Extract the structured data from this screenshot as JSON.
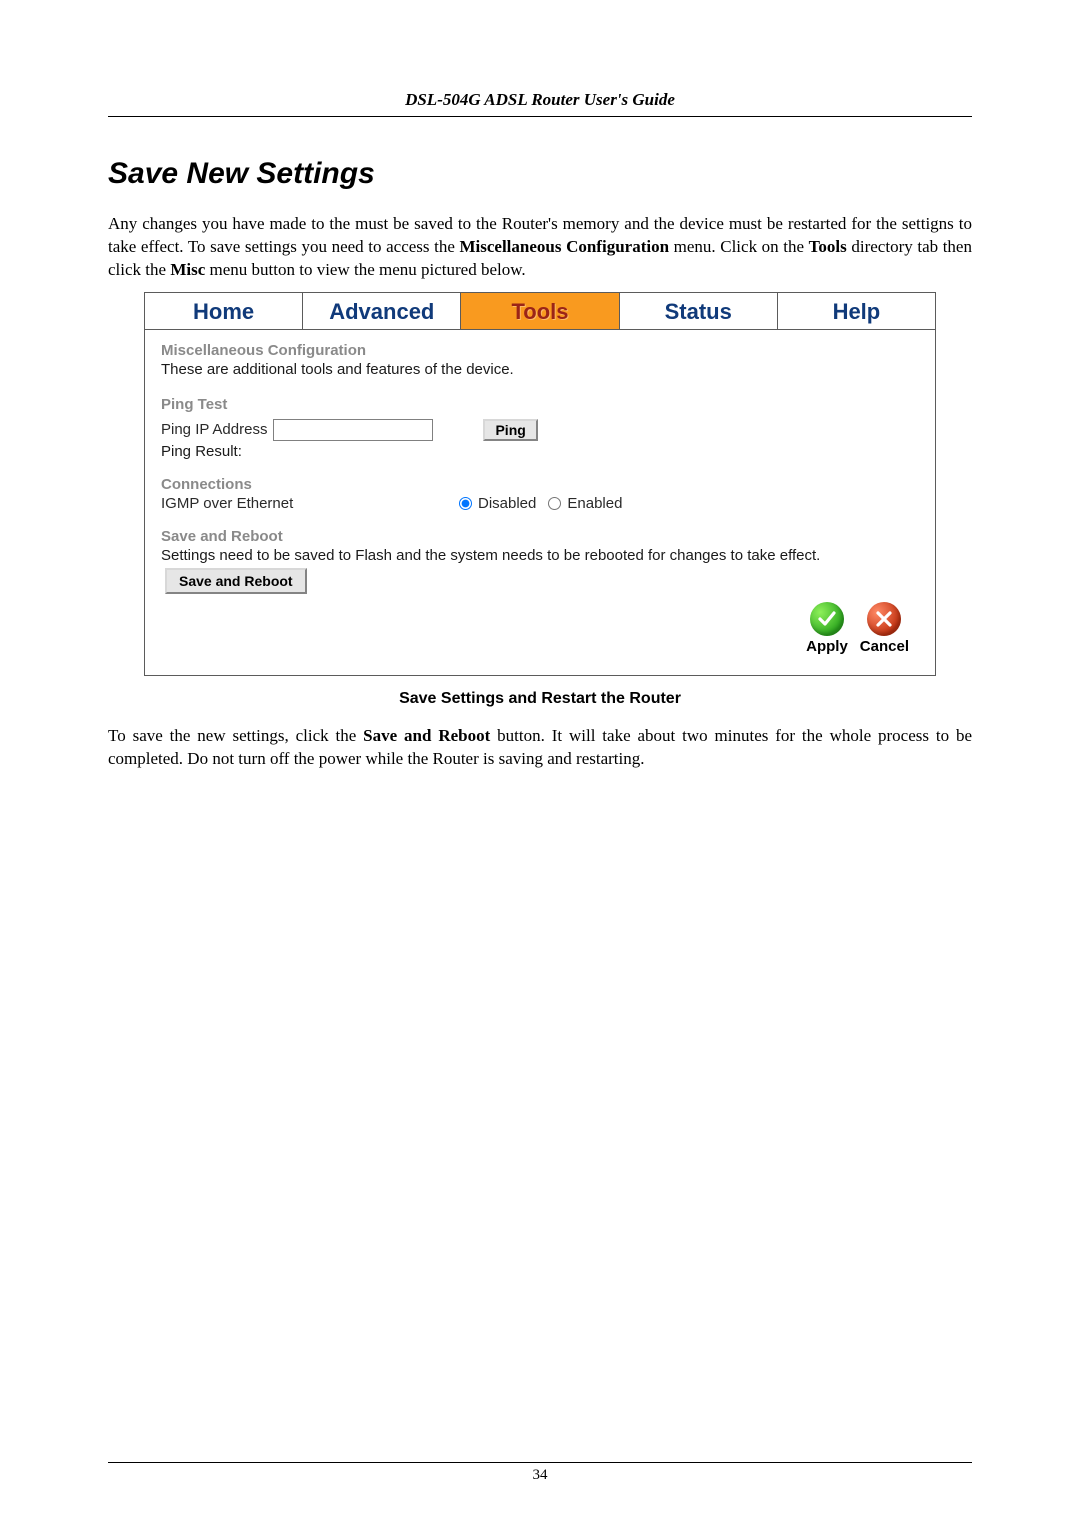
{
  "doc": {
    "running_head": "DSL-504G ADSL Router User's Guide",
    "heading": "Save New Settings",
    "intro_pre": "Any changes you have made to the must be saved to the Router's memory and the device must be restarted for the settigns to take effect. To save settings you need to access the ",
    "intro_bold1": "Miscellaneous Configuration",
    "intro_mid1": " menu. Click on the ",
    "intro_bold2": "Tools",
    "intro_mid2": " directory tab then click the ",
    "intro_bold3": "Misc",
    "intro_post": " menu button to view the menu pictured below.",
    "caption": "Save Settings and Restart the Router",
    "outro_pre": "To save the new settings, click the ",
    "outro_bold": "Save and Reboot",
    "outro_post": " button. It will take about two minutes for the whole process to be completed. Do not turn off the power while the Router is saving and restarting.",
    "page_number": "34"
  },
  "router": {
    "tabs": {
      "home": "Home",
      "advanced": "Advanced",
      "tools": "Tools",
      "status": "Status",
      "help": "Help"
    },
    "misc": {
      "title": "Miscellaneous Configuration",
      "subtitle": "These are additional tools and features of the device."
    },
    "ping": {
      "section": "Ping Test",
      "ip_label": "Ping IP Address",
      "ip_value": "",
      "button": "Ping",
      "result_label": "Ping Result:"
    },
    "conn": {
      "section": "Connections",
      "igmp_label": "IGMP over Ethernet",
      "opt_disabled": "Disabled",
      "opt_enabled": "Enabled",
      "selected": "disabled"
    },
    "save": {
      "section": "Save and Reboot",
      "note": "Settings need to be saved to Flash and the system needs to be rebooted for changes to take effect.",
      "button": "Save and Reboot"
    },
    "footer": {
      "apply": "Apply",
      "cancel": "Cancel"
    }
  }
}
